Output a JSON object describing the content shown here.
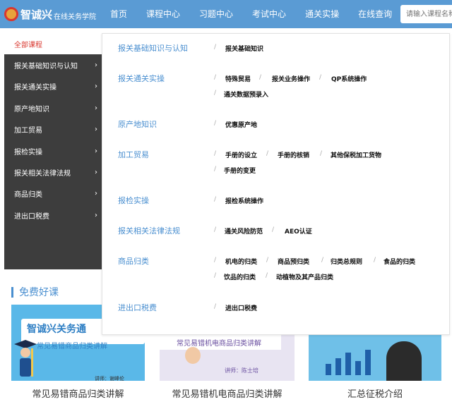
{
  "header": {
    "logo_main": "智诚兴",
    "logo_sub": "在线关务学院",
    "nav": [
      "首页",
      "课程中心",
      "习题中心",
      "考试中心",
      "通关实操",
      "在线查询"
    ],
    "search_placeholder": "请输入课程名称"
  },
  "sidebar": {
    "items": [
      {
        "label": "全部课程"
      },
      {
        "label": "报关基础知识与认知"
      },
      {
        "label": "报关通关实操"
      },
      {
        "label": "原产地知识"
      },
      {
        "label": "加工贸易"
      },
      {
        "label": "报检实操"
      },
      {
        "label": "报关相关法律法规"
      },
      {
        "label": "商品归类"
      },
      {
        "label": "进出口税费"
      }
    ],
    "arrow": "›"
  },
  "panel": {
    "separator": "/",
    "categories": [
      {
        "title": "报关基础知识与认知",
        "subs": [
          "报关基础知识"
        ]
      },
      {
        "title": "报关通关实操",
        "subs": [
          "特殊贸易",
          "报关业务操作",
          "QP系统操作",
          "通关数据预录入"
        ]
      },
      {
        "title": "原产地知识",
        "subs": [
          "优惠原产地"
        ]
      },
      {
        "title": "加工贸易",
        "subs": [
          "手册的设立",
          "手册的核销",
          "其他保税加工货物",
          "手册的变更"
        ]
      },
      {
        "title": "报检实操",
        "subs": [
          "报检系统操作"
        ]
      },
      {
        "title": "报关相关法律法规",
        "subs": [
          "通关风险防范",
          "AEO认证"
        ]
      },
      {
        "title": "商品归类",
        "subs": [
          "机电的归类",
          "商品预归类",
          "归类总规则",
          "食品的归类",
          "饮品的归类",
          "动植物及其产品归类"
        ]
      },
      {
        "title": "进出口税费",
        "subs": [
          "进出口税费"
        ]
      }
    ]
  },
  "free": {
    "title": "免费好课",
    "cards": [
      {
        "brand": "智诚兴关务通",
        "subtitle": "常见易错商品归类讲解",
        "lecturer": "讲师：谢峰伦",
        "caption": "常见易错商品归类讲解"
      },
      {
        "subtitle": "常见易错机电商品归类讲解",
        "lecturer": "讲师：陈士培",
        "caption": "常见易错机电商品归类讲解"
      },
      {
        "caption": "汇总征税介绍"
      }
    ]
  },
  "colors": {
    "nav_bg": "#5a9bd4",
    "sidebar_bg": "#3d3d3d",
    "accent_red": "#d9382f",
    "link_blue": "#4a8fd0"
  }
}
